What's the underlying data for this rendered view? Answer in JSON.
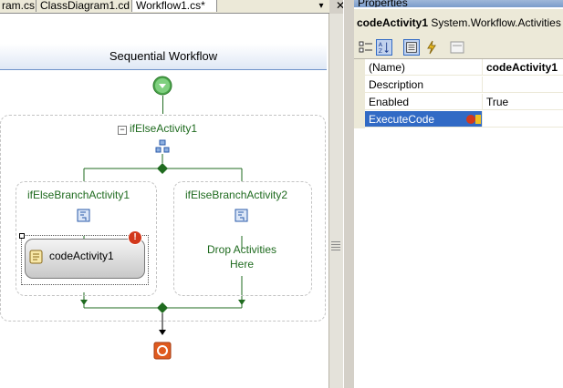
{
  "tabs": [
    {
      "label": "ram.cs",
      "active": false
    },
    {
      "label": "ClassDiagram1.cd",
      "active": false
    },
    {
      "label": "Workflow1.cs*",
      "active": true
    }
  ],
  "tab_nav_glyph": "▾",
  "close_glyph": "✕",
  "designer": {
    "header": "Sequential Workflow",
    "ifelse_label": "ifElseActivity1",
    "branch1_label": "ifElseBranchActivity1",
    "branch2_label": "ifElseBranchActivity2",
    "code_activity_label": "codeActivity1",
    "drop_line1": "Drop Activities",
    "drop_line2": "Here",
    "collapse_glyph": "−",
    "error_glyph": "!"
  },
  "properties": {
    "title": "Properties",
    "object_name": "codeActivity1",
    "object_type": "System.Workflow.Activities",
    "rows": [
      {
        "name": "(Name)",
        "value": "codeActivity1"
      },
      {
        "name": "Description",
        "value": ""
      },
      {
        "name": "Enabled",
        "value": "True"
      },
      {
        "name": "ExecuteCode",
        "value": ""
      }
    ]
  },
  "colors": {
    "selection": "#316ac5",
    "connector": "#1f6b1f",
    "header_border": "#6e93c9",
    "error": "#d2381b",
    "stop": "#e05a1e"
  }
}
